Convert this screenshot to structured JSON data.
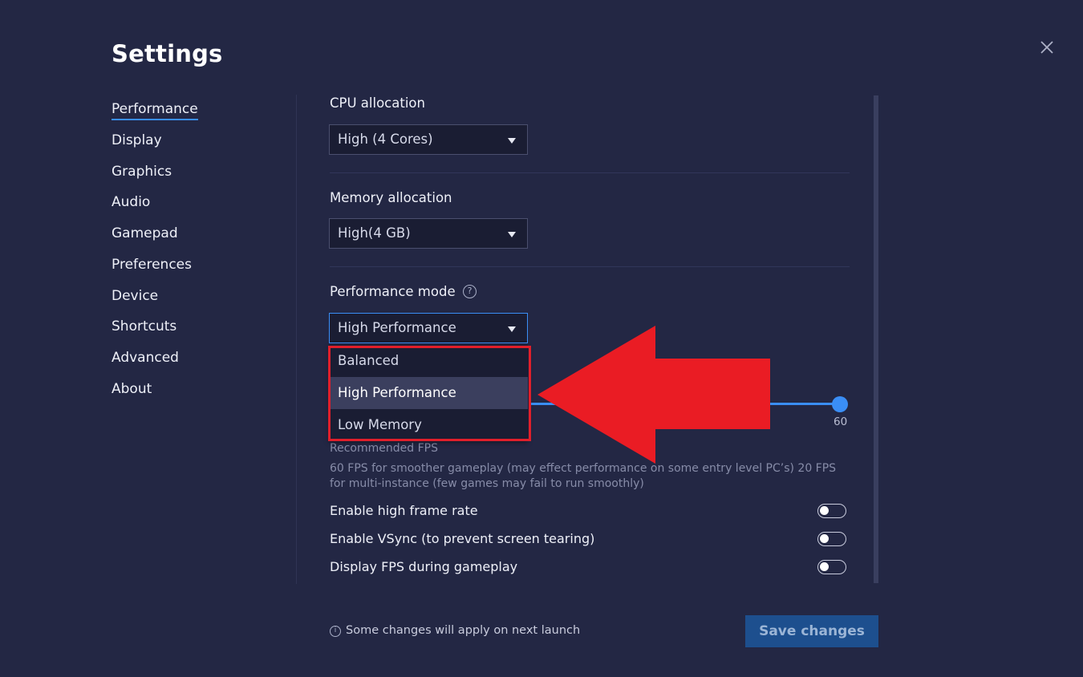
{
  "window": {
    "title": "Settings",
    "close_icon": "close-x-icon"
  },
  "sidebar": {
    "items": [
      {
        "label": "Performance",
        "active": true
      },
      {
        "label": "Display"
      },
      {
        "label": "Graphics"
      },
      {
        "label": "Audio"
      },
      {
        "label": "Gamepad"
      },
      {
        "label": "Preferences"
      },
      {
        "label": "Device"
      },
      {
        "label": "Shortcuts"
      },
      {
        "label": "Advanced"
      },
      {
        "label": "About"
      }
    ]
  },
  "performance": {
    "cpu": {
      "label": "CPU allocation",
      "value": "High (4 Cores)"
    },
    "memory": {
      "label": "Memory allocation",
      "value": "High(4 GB)"
    },
    "mode": {
      "label": "Performance mode",
      "help_icon": "question-mark-icon",
      "value": "High Performance",
      "options": [
        "Balanced",
        "High Performance",
        "Low Memory"
      ],
      "selected_option": "High Performance"
    },
    "fps": {
      "value": "60",
      "label": "Recommended FPS",
      "description": "60 FPS for smoother gameplay (may effect performance on some entry level PC’s) 20 FPS for multi-instance (few games may fail to run smoothly)"
    },
    "toggles": [
      {
        "label": "Enable high frame rate",
        "on": false
      },
      {
        "label": "Enable VSync (to prevent screen tearing)",
        "on": false
      },
      {
        "label": "Display FPS during gameplay",
        "on": false
      }
    ]
  },
  "footer": {
    "note": "Some changes will apply on next launch",
    "note_icon": "info-icon",
    "save_label": "Save changes"
  },
  "colors": {
    "background": "#232744",
    "accent": "#3a8ef6",
    "annotation": "#e11f2b"
  }
}
